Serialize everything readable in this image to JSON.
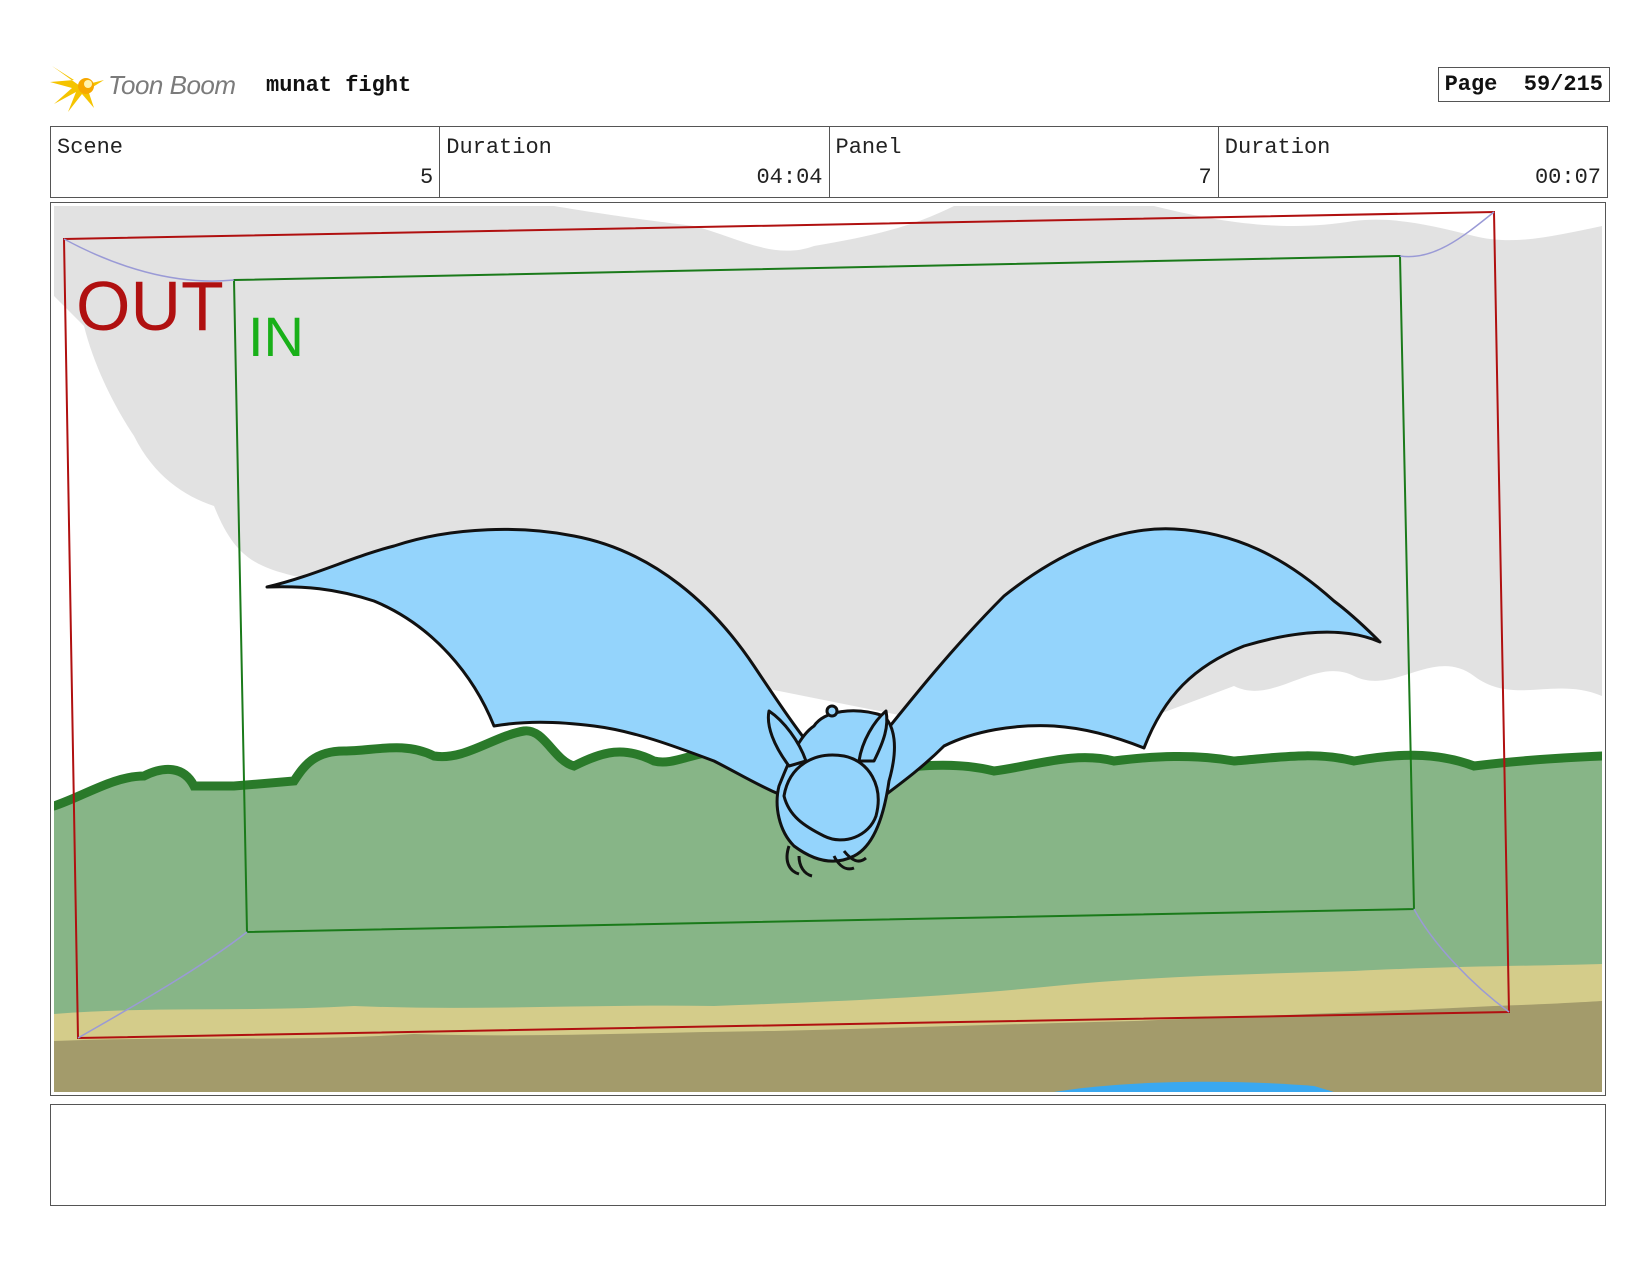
{
  "header": {
    "logo_text": "Toon Boom",
    "project_title": "munat fight",
    "page_label": "Page",
    "page_value": "59/215"
  },
  "info": {
    "scene_label": "Scene",
    "scene_value": "5",
    "scene_duration_label": "Duration",
    "scene_duration_value": "04:04",
    "panel_label": "Panel",
    "panel_value": "7",
    "panel_duration_label": "Duration",
    "panel_duration_value": "00:07"
  },
  "panel": {
    "out_label": "OUT",
    "in_label": "IN"
  },
  "colors": {
    "out_frame": "#b01010",
    "in_frame": "#1a7a1a",
    "in_text": "#19b019",
    "bat_fill": "#94d4fc",
    "foliage": "#87b587",
    "foliage_edge": "#2a7a2a",
    "sky": "#e2e2e2",
    "sand": "#d4cc8a",
    "dirt": "#a39b6b",
    "water": "#3aa8f0"
  },
  "notes": {
    "text": ""
  }
}
